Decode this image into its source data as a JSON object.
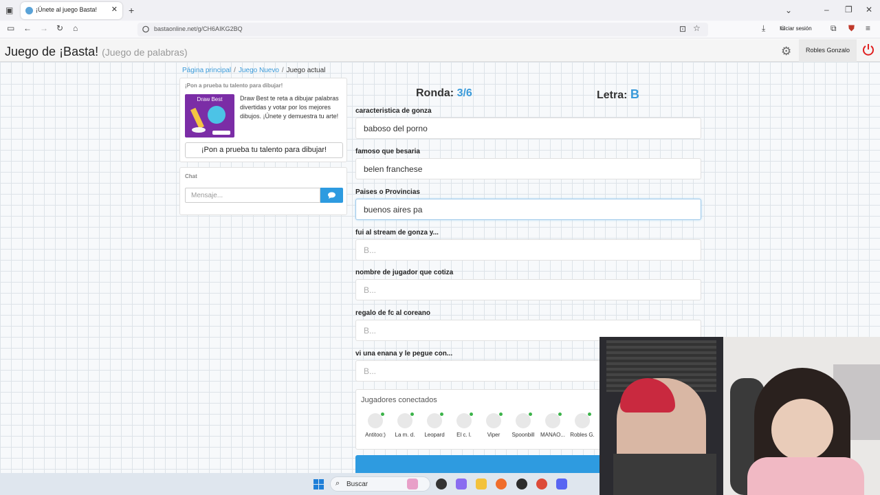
{
  "browser": {
    "tab_title": "¡Únete al juego Basta!",
    "url": "bastaonline.net/g/CH6AIKG2BQ",
    "signin_label": "Iniciar sesión"
  },
  "app": {
    "title": "Juego de ¡Basta!",
    "subtitle": "(Juego de palabras)",
    "user_name": "Robles Gonzalo"
  },
  "breadcrumb": {
    "home": "Página principal",
    "new_game": "Juego Nuevo",
    "current": "Juego actual"
  },
  "promo": {
    "heading": "¡Pon a prueba tu talento para dibujar!",
    "image_title": "Draw Best",
    "text": "Draw Best te reta a dibujar palabras divertidas y votar por los mejores dibujos. ¡Únete y demuestra tu arte!",
    "button": "¡Pon a prueba tu talento para dibujar!"
  },
  "chat": {
    "heading": "Chat",
    "placeholder": "Mensaje..."
  },
  "game": {
    "round_label": "Ronda:",
    "round_value": "3/6",
    "letter_label": "Letra:",
    "letter_value": "B",
    "categories": [
      {
        "label": "caracteristica de gonza",
        "value": "baboso del porno"
      },
      {
        "label": "famoso que besaria",
        "value": "belen franchese"
      },
      {
        "label": "Paises o Provincias",
        "value": "buenos aires pa"
      },
      {
        "label": "fui al stream de gonza y...",
        "placeholder": "B..."
      },
      {
        "label": "nombre de jugador que cotiza",
        "placeholder": "B..."
      },
      {
        "label": "regalo de fc al coreano",
        "placeholder": "B..."
      },
      {
        "label": "vi una enana y le pegue con...",
        "placeholder": "B..."
      }
    ]
  },
  "players": {
    "title": "Jugadores conectados",
    "list": [
      "Antitoo:)",
      "La m. d.",
      "Leopard",
      "El c. l.",
      "Viper",
      "Spoonbill",
      "MANAO...",
      "Robles G."
    ]
  },
  "taskbar": {
    "search_label": "Buscar"
  },
  "colors": {
    "accent": "#2e9be0",
    "online": "#3cb34a"
  }
}
